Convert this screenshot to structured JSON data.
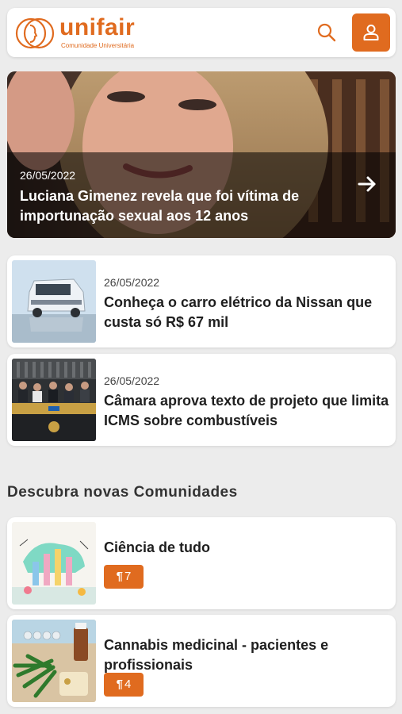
{
  "brand": {
    "name": "unifair",
    "tagline": "Comunidade Universitária",
    "accent": "#e06b1f"
  },
  "header": {
    "search_icon": "search-icon",
    "user_icon": "user-icon"
  },
  "featured": {
    "date": "26/05/2022",
    "title": "Luciana Gimenez revela que foi vítima de importunação sexual aos 12 anos"
  },
  "news": [
    {
      "date": "26/05/2022",
      "title": "Conheça o carro elétrico da Nissan que custa só R$ 67 mil"
    },
    {
      "date": "26/05/2022",
      "title": "Câmara aprova texto de projeto que limita ICMS sobre combustíveis"
    }
  ],
  "communities_section": {
    "title": "Descubra novas Comunidades",
    "items": [
      {
        "name": "Ciência de tudo",
        "count": "7"
      },
      {
        "name": "Cannabis medicinal - pacientes e profissionais",
        "count": "4"
      }
    ]
  }
}
